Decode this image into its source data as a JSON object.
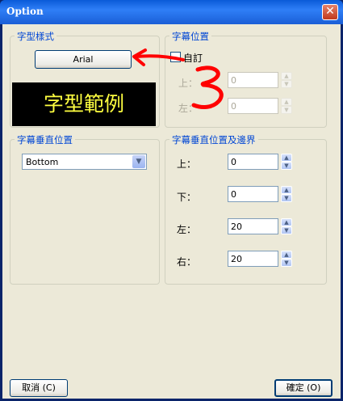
{
  "window": {
    "title": "Option",
    "close_glyph": "✕"
  },
  "font_style": {
    "group_title": "字型樣式",
    "font_button_label": "Arial",
    "preview_text": "字型範例",
    "preview_bg": "#000000",
    "preview_color": "#ffff40"
  },
  "subtitle_position": {
    "group_title": "字幕位置",
    "custom_label": "自訂",
    "custom_checked": false,
    "top_label": "上：",
    "top_value": "0",
    "left_label": "左：",
    "left_value": "0"
  },
  "vertical_position": {
    "group_title": "字幕垂直位置",
    "selected": "Bottom"
  },
  "vertical_margins": {
    "group_title": "字幕垂直位置及邊界",
    "top_label": "上：",
    "top_value": "0",
    "bottom_label": "下：",
    "bottom_value": "0",
    "left_label": "左：",
    "left_value": "20",
    "right_label": "右：",
    "right_value": "20"
  },
  "footer": {
    "cancel_label": "取消 (C)",
    "ok_label": "確定 (O)"
  },
  "colors": {
    "accent": "#0046d5",
    "annotation": "#ff0000"
  }
}
